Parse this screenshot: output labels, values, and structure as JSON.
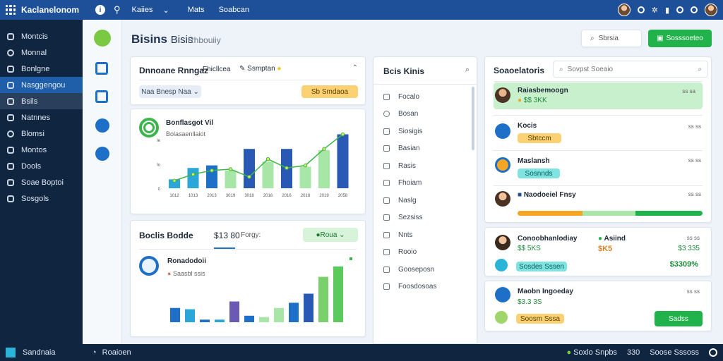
{
  "topbar": {
    "app_title": "Kaclanelonom",
    "nav": [
      "Kaiies",
      "Mats",
      "Soabcan"
    ]
  },
  "sidebar": {
    "items": [
      "Montcis",
      "Monnal",
      "Bonlgne",
      "Nasggengou",
      "Bsils",
      "Natnnes",
      "Blomsi",
      "Montos",
      "Dools",
      "Soae Boptoi",
      "Sosgols"
    ]
  },
  "page": {
    "title": "Bisins",
    "title_b": "Bisis",
    "subtitle": "Rhbouiiy",
    "search_label": "Sbrsia",
    "add_button": "Sosssoeteo"
  },
  "card1": {
    "title": "Dnnoane Rnngaz",
    "tab": "Fhicllcea",
    "tab2": "Ssmptan",
    "filter": "Naa Bnesp Naa",
    "action": "Sb Smdaoa"
  },
  "chart1": {
    "legend_title": "Bonflasgot Vil",
    "legend_sub": "Bolasaenllaiot"
  },
  "card2": {
    "title": "Boclis Bodde",
    "value": "$13 80",
    "value_label": "Forgy:",
    "button": "Roua"
  },
  "chart2": {
    "legend_title": "Ronadodoii",
    "legend_sub": "Saasbl ssis"
  },
  "middle": {
    "title": "Bcis Kinis",
    "items": [
      "Focalo",
      "Bosan",
      "Siosigis",
      "Basian",
      "Rasis",
      "Fhoiam",
      "Naslg",
      "Sezsiss",
      "Nnts",
      "Rooio",
      "Gooseposn",
      "Foosdosoas"
    ]
  },
  "right": {
    "title": "Soaoelatoris",
    "search_placeholder": "Sovpst Soeaio"
  },
  "people": [
    {
      "name": "Raiasbemoogn",
      "value": "$$ 3KK",
      "time": "ss sa",
      "pill": ""
    },
    {
      "name": "Kocis",
      "value": "",
      "time": "ss ss",
      "pill": "Sbtccm"
    },
    {
      "name": "Maslansh",
      "value": "",
      "time": "ss ss",
      "pill": "Sosnnds"
    },
    {
      "name": "Naodoeiel Fnsy",
      "value": "",
      "time": "ss ss",
      "pill": ""
    }
  ],
  "deal_card": {
    "name": "Conoobhanlodiay",
    "name2": "Asiind",
    "v1": "$$ 5KS",
    "v2": "$K5",
    "v3": "$3 335",
    "v4": "$3309%",
    "pill": "Sosdes Sssen"
  },
  "deal_card2": {
    "name": "Maobn Ingoeday",
    "value": "$3.3 3S",
    "pill": "Soosm Sssa",
    "button": "Sadss",
    "time": "ss ss"
  },
  "bottombar": {
    "brand": "Sandnaia",
    "status": "Roaioen",
    "items": [
      "Soxlo Snpbs",
      "330",
      "Soose Sssoss"
    ]
  },
  "chart_data": [
    {
      "type": "bar",
      "categories": [
        "1012",
        "1013",
        "2013",
        "3019",
        "3018",
        "2016",
        "2016",
        "2018",
        "2019",
        "2058"
      ],
      "values": [
        14,
        32,
        36,
        28,
        62,
        42,
        62,
        34,
        60,
        85
      ],
      "line": [
        12,
        22,
        28,
        30,
        18,
        46,
        32,
        36,
        62,
        85
      ],
      "yticks": [
        "0",
        "lo",
        "le"
      ],
      "ylim": [
        0,
        100
      ]
    },
    {
      "type": "bar",
      "values": [
        22,
        20,
        4,
        4,
        32,
        10,
        8,
        22,
        30,
        44,
        70,
        86
      ],
      "ylim": [
        0,
        100
      ]
    }
  ],
  "colors": {
    "accent": "#1e4f99",
    "green": "#22b24c",
    "orange": "#f5a623",
    "cyan": "#2ab5d8",
    "sidebar": "#0f2540"
  }
}
